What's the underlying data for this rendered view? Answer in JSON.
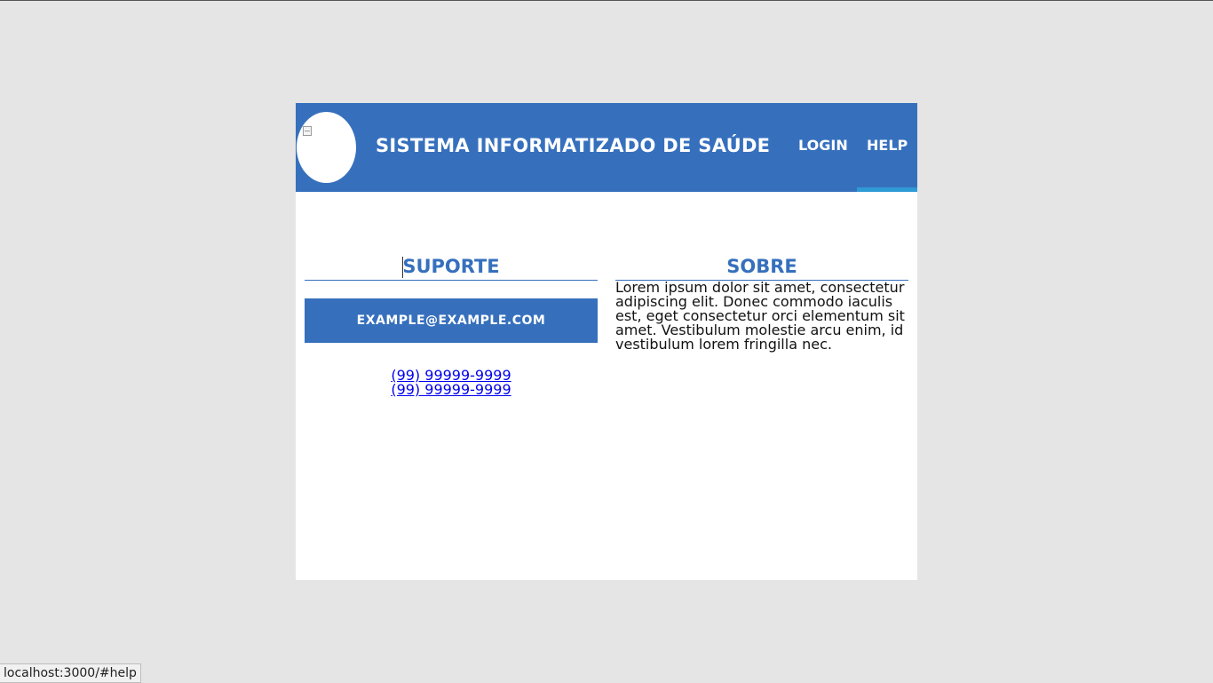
{
  "header": {
    "title": "SISTEMA INFORMATIZADO DE SAÚDE",
    "nav": {
      "login": "LOGIN",
      "help": "HELP"
    },
    "active_tab": "help"
  },
  "support": {
    "title": "SUPORTE",
    "email_button": "EXAMPLE@EXAMPLE.COM",
    "phones": [
      "(99) 99999-9999",
      "(99) 99999-9999"
    ]
  },
  "about": {
    "title": "SOBRE",
    "text": "Lorem ipsum dolor sit amet, consectetur adipiscing elit. Donec commodo iaculis est, eget consectetur orci elementum sit amet. Vestibulum molestie arcu enim, id vestibulum lorem fringilla nec."
  },
  "status_bar": {
    "url": "localhost:3000/#help"
  },
  "colors": {
    "primary": "#3670bd",
    "active_indicator": "#2e9ad6",
    "page_bg": "#e5e5e5"
  }
}
